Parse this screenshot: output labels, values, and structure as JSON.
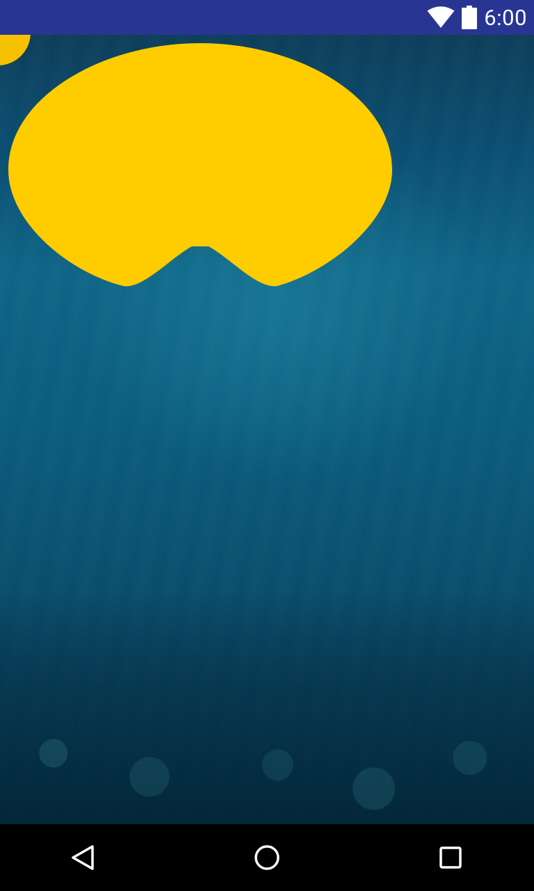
{
  "status_bar": {
    "time": "6:00",
    "icons": [
      "wifi-icon",
      "battery-icon"
    ]
  },
  "background": {
    "description_icon": "underwater-scene"
  },
  "colors": {
    "status_bar": "#283593",
    "accent_yellow": "#ffcc00",
    "nav_bar": "#000000"
  },
  "nav_bar": {
    "buttons": [
      "back-icon",
      "home-icon",
      "recents-icon"
    ]
  }
}
